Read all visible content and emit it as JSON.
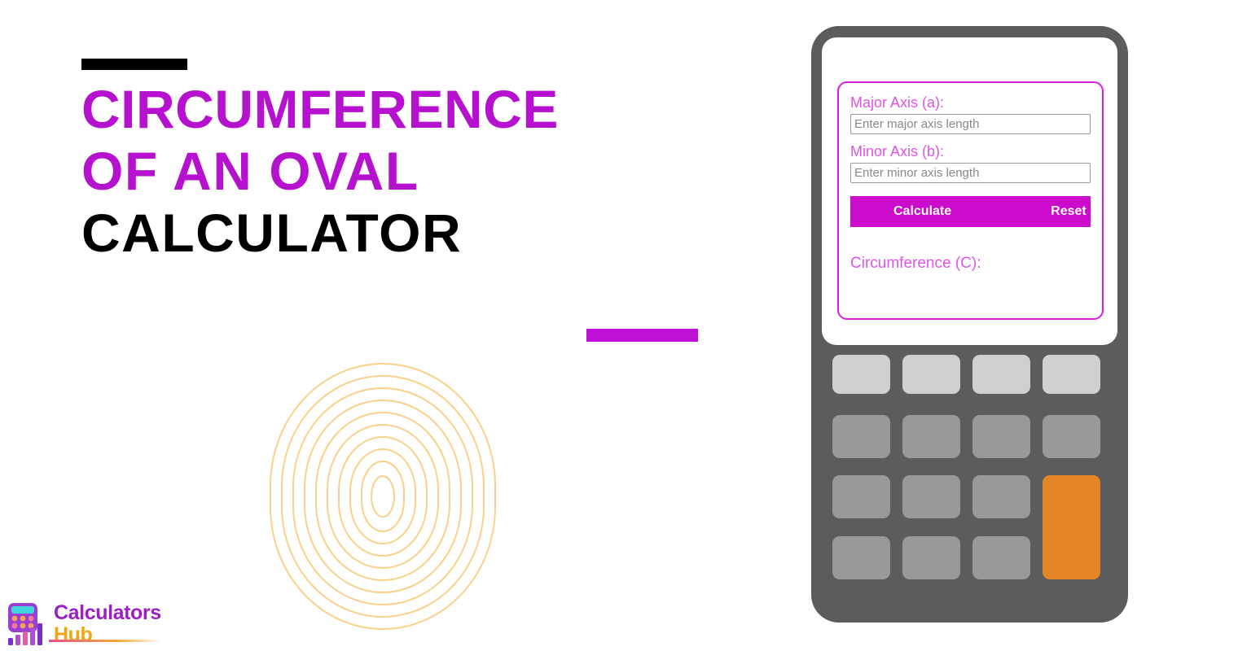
{
  "page": {
    "background_color": "#ffffff",
    "accent_magenta": "#bf10d6",
    "accent_black": "#000000",
    "accent_orange": "#e28526",
    "oval_stroke_color": "#fbd08a"
  },
  "hero": {
    "top_rule": "",
    "bottom_rule": "",
    "title_lines": [
      "Circumference",
      "of an Oval",
      "Calculator"
    ],
    "decoration_name": "concentric-oval-rings",
    "ring_count": 10
  },
  "logo": {
    "word_primary": "Calculators",
    "word_secondary": "Hub",
    "primary_color": "#9b1fc4",
    "secondary_color": "#f0a613",
    "mark_name": "calculator-bars-logo-icon"
  },
  "device": {
    "frame_color": "#5a5c5e",
    "screen_color": "#ffffff",
    "keypad": {
      "rows": 4,
      "cols": 4,
      "light_key_color": "#cfd0cf",
      "mid_key_color": "#97999b",
      "accent_key_color": "#e28526"
    }
  },
  "calculator": {
    "panel_border_color": "#d81fe0",
    "fields": [
      {
        "label": "Major Axis (a):",
        "placeholder": "Enter major axis length",
        "value": ""
      },
      {
        "label": "Minor Axis (b):",
        "placeholder": "Enter minor axis length",
        "value": ""
      }
    ],
    "buttons": {
      "calculate": "Calculate",
      "reset": "Reset",
      "bar_color": "#cc0ccc"
    },
    "result": {
      "label": "Circumference (C):",
      "value": ""
    }
  }
}
